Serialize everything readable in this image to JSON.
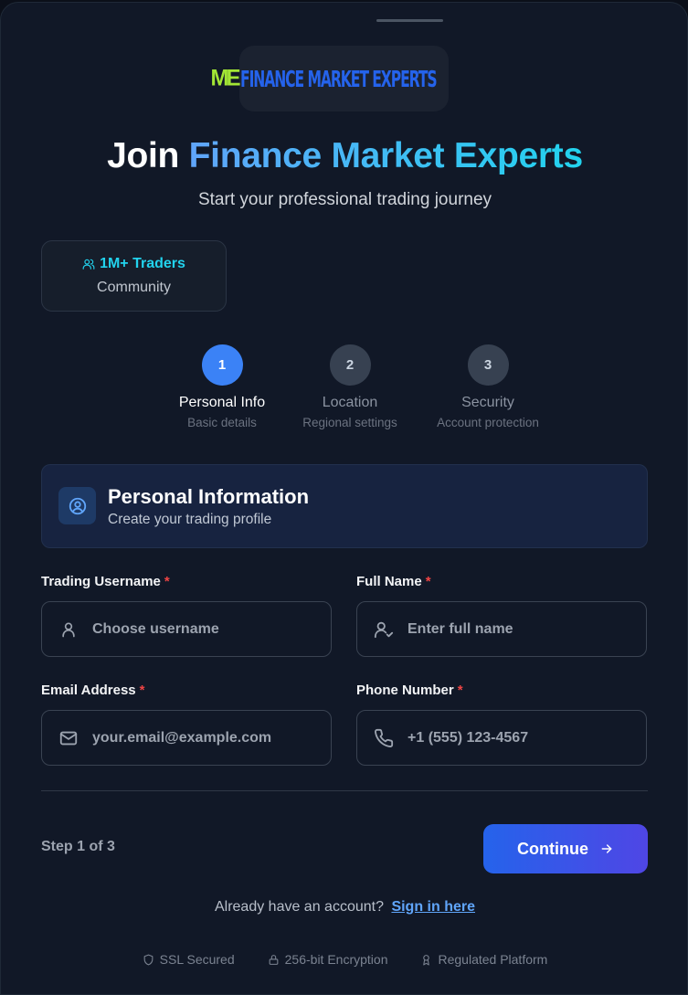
{
  "logo": {
    "mark": "ME",
    "text": "FINANCE MARKET EXPERTS"
  },
  "header": {
    "title_prefix": "Join",
    "title_accent": "Finance Market Experts",
    "subtitle": "Start your professional trading journey"
  },
  "stat": {
    "value": "1M+ Traders",
    "label": "Community",
    "icon": "users-icon"
  },
  "steps": [
    {
      "number": "1",
      "title": "Personal Info",
      "subtitle": "Basic details",
      "active": true
    },
    {
      "number": "2",
      "title": "Location",
      "subtitle": "Regional settings",
      "active": false
    },
    {
      "number": "3",
      "title": "Security",
      "subtitle": "Account protection",
      "active": false
    }
  ],
  "section": {
    "title": "Personal Information",
    "subtitle": "Create your trading profile",
    "icon": "user-circle-icon"
  },
  "fields": {
    "username": {
      "label": "Trading Username",
      "required": "*",
      "placeholder": "Choose username",
      "value": "",
      "icon": "user-icon"
    },
    "fullname": {
      "label": "Full Name",
      "required": "*",
      "placeholder": "Enter full name",
      "value": "",
      "icon": "user-check-icon"
    },
    "email": {
      "label": "Email Address",
      "required": "*",
      "placeholder": "your.email@example.com",
      "value": "",
      "icon": "mail-icon"
    },
    "phone": {
      "label": "Phone Number",
      "required": "*",
      "placeholder": "+1 (555) 123-4567",
      "value": "",
      "icon": "phone-icon"
    }
  },
  "footer": {
    "step_count": "Step 1 of 3",
    "continue_label": "Continue",
    "signin_prompt": "Already have an account?",
    "signin_link": "Sign in here"
  },
  "badges": [
    {
      "label": "SSL Secured",
      "icon": "shield-icon"
    },
    {
      "label": "256-bit Encryption",
      "icon": "lock-icon"
    },
    {
      "label": "Regulated Platform",
      "icon": "award-icon"
    }
  ],
  "colors": {
    "background": "#111827",
    "accent": "#3b82f6",
    "accent_cyan": "#22d3ee",
    "logo_green": "#a3e635",
    "required": "#ef4444",
    "link": "#60a5fa"
  }
}
